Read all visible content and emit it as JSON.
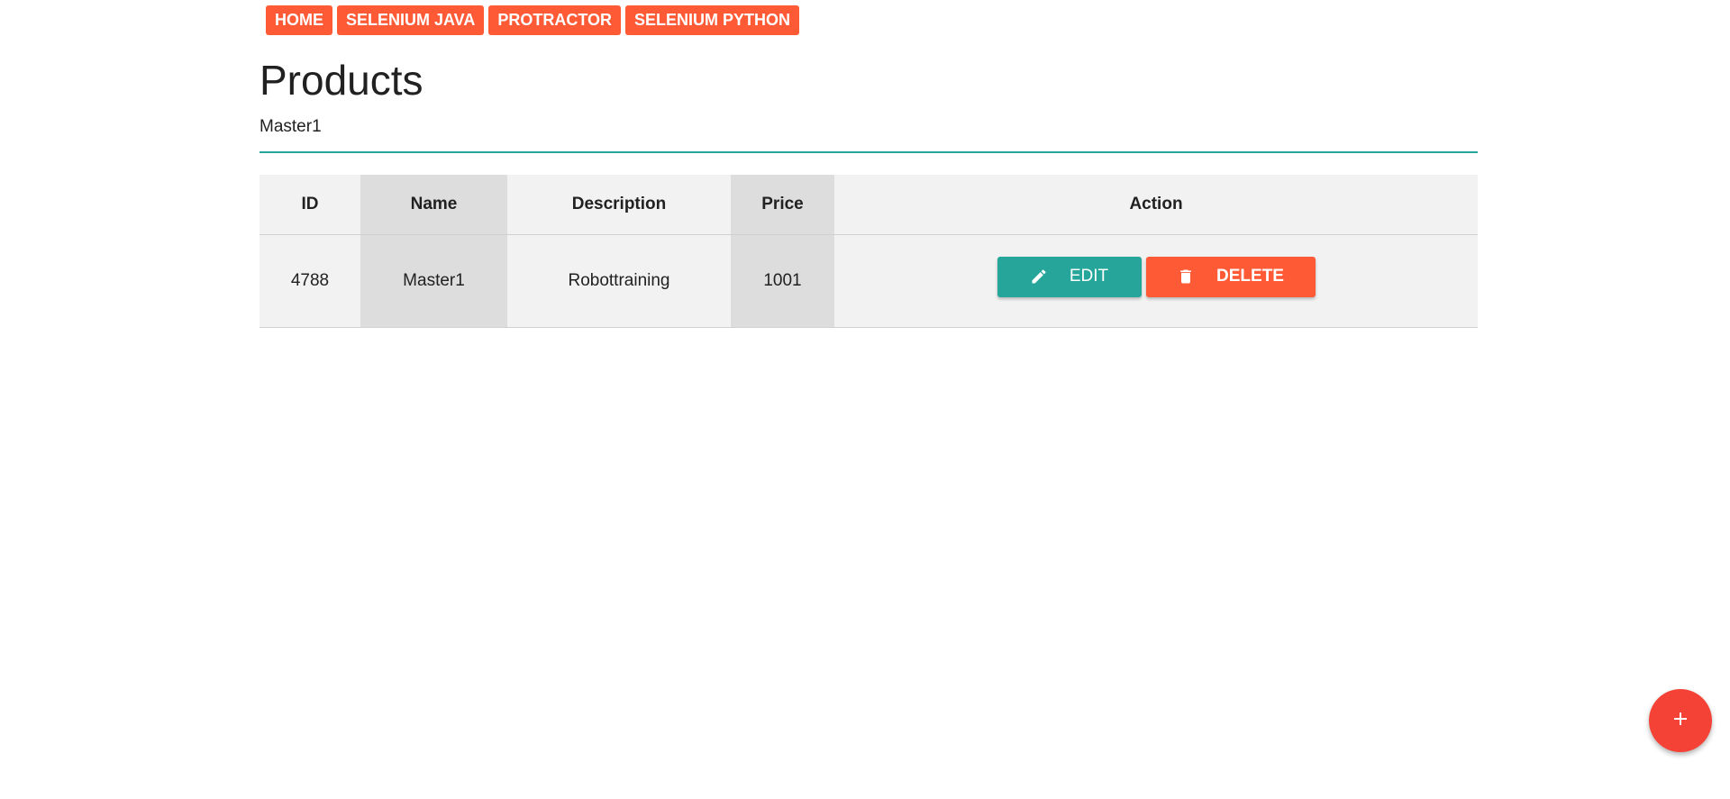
{
  "nav": {
    "items": [
      {
        "label": "HOME"
      },
      {
        "label": "SELENIUM JAVA"
      },
      {
        "label": "PROTRACTOR"
      },
      {
        "label": "SELENIUM PYTHON"
      }
    ]
  },
  "page": {
    "title": "Products"
  },
  "search": {
    "value": "Master1"
  },
  "table": {
    "headers": {
      "id": "ID",
      "name": "Name",
      "description": "Description",
      "price": "Price",
      "action": "Action"
    },
    "rows": [
      {
        "id": "4788",
        "name": "Master1",
        "description": "Robottraining",
        "price": "1001",
        "edit_label": "EDIT",
        "delete_label": "DELETE"
      }
    ]
  },
  "colors": {
    "accent_orange": "#ff5a36",
    "accent_teal": "#26a69a",
    "fab_red": "#f44336"
  },
  "icons": {
    "edit": "pencil-icon",
    "delete": "trash-icon",
    "fab": "plus-icon"
  }
}
